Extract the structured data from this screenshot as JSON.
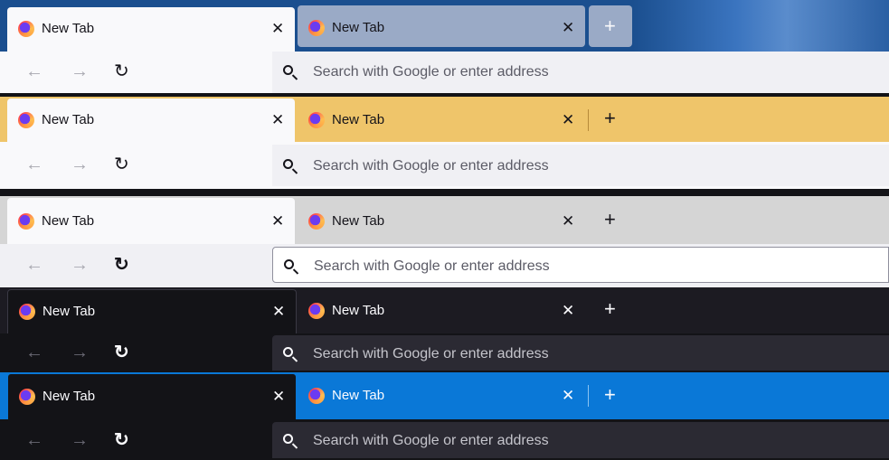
{
  "tab_label": "New Tab",
  "close_glyph": "✕",
  "newtab_glyph": "+",
  "back_glyph": "←",
  "forward_glyph": "→",
  "reload_glyph": "↻",
  "urlbar_placeholder": "Search with Google or enter address",
  "themes": [
    {
      "name": "alpenglow-blue",
      "colors": {
        "frame": "#1b4f8f",
        "active_tab": "#f9f9fb",
        "inactive_tab": "#9aaac6",
        "nav": "#f9f9fb",
        "urlbar": "#f0f0f4",
        "text": "#15141a"
      }
    },
    {
      "name": "yellow",
      "colors": {
        "frame": "#efc56a",
        "active_tab": "#f9f9fb",
        "nav": "#f9f9fb",
        "urlbar": "#f0f0f4",
        "text": "#15141a"
      }
    },
    {
      "name": "light",
      "colors": {
        "frame": "#d5d5d5",
        "active_tab": "#f9f9fb",
        "nav": "#f0f0f4",
        "urlbar": "#ffffff",
        "text": "#15141a"
      }
    },
    {
      "name": "dark",
      "colors": {
        "frame": "#1c1b22",
        "active_tab": "#131317",
        "nav": "#2b2a33",
        "urlbar": "#42414d",
        "text": "#fbfbfe"
      }
    },
    {
      "name": "dark-blue-accent",
      "colors": {
        "frame": "#0a78d7",
        "active_tab": "#131317",
        "nav": "#2b2a33",
        "urlbar": "#42414d",
        "text": "#fbfbfe"
      }
    }
  ]
}
